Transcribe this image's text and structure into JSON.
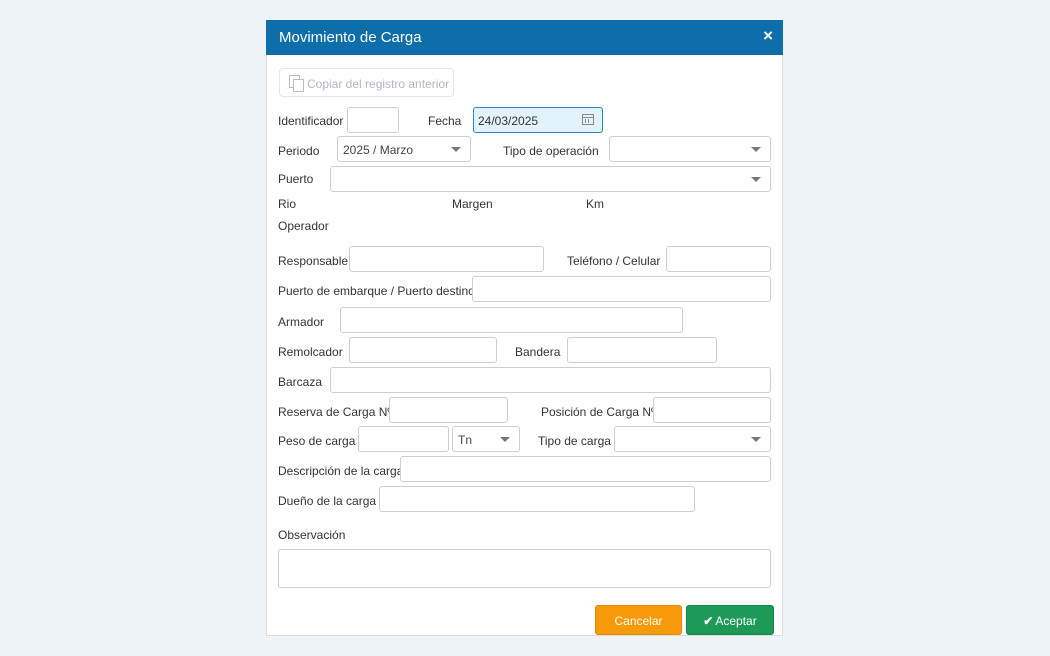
{
  "dialog": {
    "title": "Movimiento de Carga",
    "close_icon": "×"
  },
  "copy_button": {
    "label": "Copiar del registro anterior",
    "icon": "copy-icon"
  },
  "form": {
    "identificador_label": "Identificador",
    "identificador_value": "",
    "fecha_label": "Fecha",
    "fecha_value": "24/03/2025",
    "periodo_label": "Periodo",
    "periodo_value": "2025 / Marzo",
    "tipo_operacion_label": "Tipo de operación",
    "tipo_operacion_value": "",
    "puerto_label": "Puerto",
    "puerto_value": "",
    "rio_label": "Rio",
    "margen_label": "Margen",
    "km_label": "Km",
    "operador_label": "Operador",
    "responsable_label": "Responsable",
    "responsable_value": "",
    "telefono_label": "Teléfono / Celular",
    "telefono_value": "",
    "puerto_embarque_label": "Puerto de embarque / Puerto destino",
    "puerto_embarque_value": "",
    "armador_label": "Armador",
    "armador_value": "",
    "remolcador_label": "Remolcador",
    "remolcador_value": "",
    "bandera_label": "Bandera",
    "bandera_value": "",
    "barcaza_label": "Barcaza",
    "barcaza_value": "",
    "reserva_label": "Reserva de Carga Nº",
    "reserva_value": "",
    "posicion_label": "Posición de Carga Nº",
    "posicion_value": "",
    "peso_label": "Peso de carga",
    "peso_value": "",
    "unidad_value": "Tn",
    "tipo_carga_label": "Tipo de carga",
    "tipo_carga_value": "",
    "descripcion_label": "Descripción de la carga",
    "descripcion_value": "",
    "dueno_label": "Dueño de la carga",
    "dueno_value": "",
    "observacion_label": "Observación",
    "observacion_value": ""
  },
  "buttons": {
    "cancel_label": "Cancelar",
    "accept_label": "Aceptar",
    "accept_icon": "✔"
  },
  "colors": {
    "header": "#0d6eaa",
    "cancel": "#f79a0a",
    "accept": "#1d9a57",
    "date_highlight": "#e3f3fc"
  }
}
